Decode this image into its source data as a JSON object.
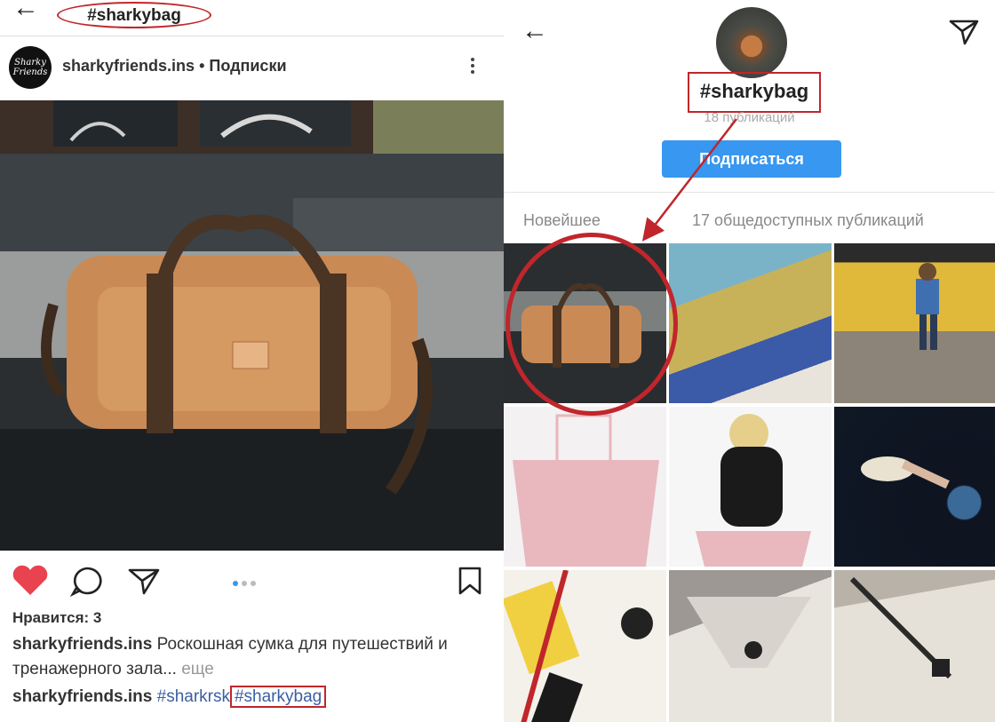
{
  "left": {
    "hashtag_header": "#sharkybag",
    "avatar_text": "Sharky Friends",
    "username": "sharkyfriends.ins",
    "separator": " • ",
    "follow_status": "Подписки",
    "likes": "Нравится: 3",
    "caption_user": "sharkyfriends.ins",
    "caption_text": " Роскошная сумка для путешествий и тренажерного зала... ",
    "caption_more": "еще",
    "tags_user": "sharkyfriends.ins",
    "tag1": "#sharkrsk",
    "tag2": "#sharkybag"
  },
  "right": {
    "hashtag": "#sharkybag",
    "posts_count": "18 публикаций",
    "follow_button": "Подписаться",
    "tab_newest": "Новейшее",
    "public_posts": "17 общедоступных публикаций"
  },
  "colors": {
    "accent_blue": "#3897f0",
    "annotation_red": "#c0262b",
    "hashtag_blue": "#3a5fa4",
    "like_red": "#e8434f"
  },
  "icons": [
    "back-arrow-icon",
    "more-icon",
    "heart-icon",
    "comment-icon",
    "share-icon",
    "bookmark-icon",
    "send-icon"
  ]
}
